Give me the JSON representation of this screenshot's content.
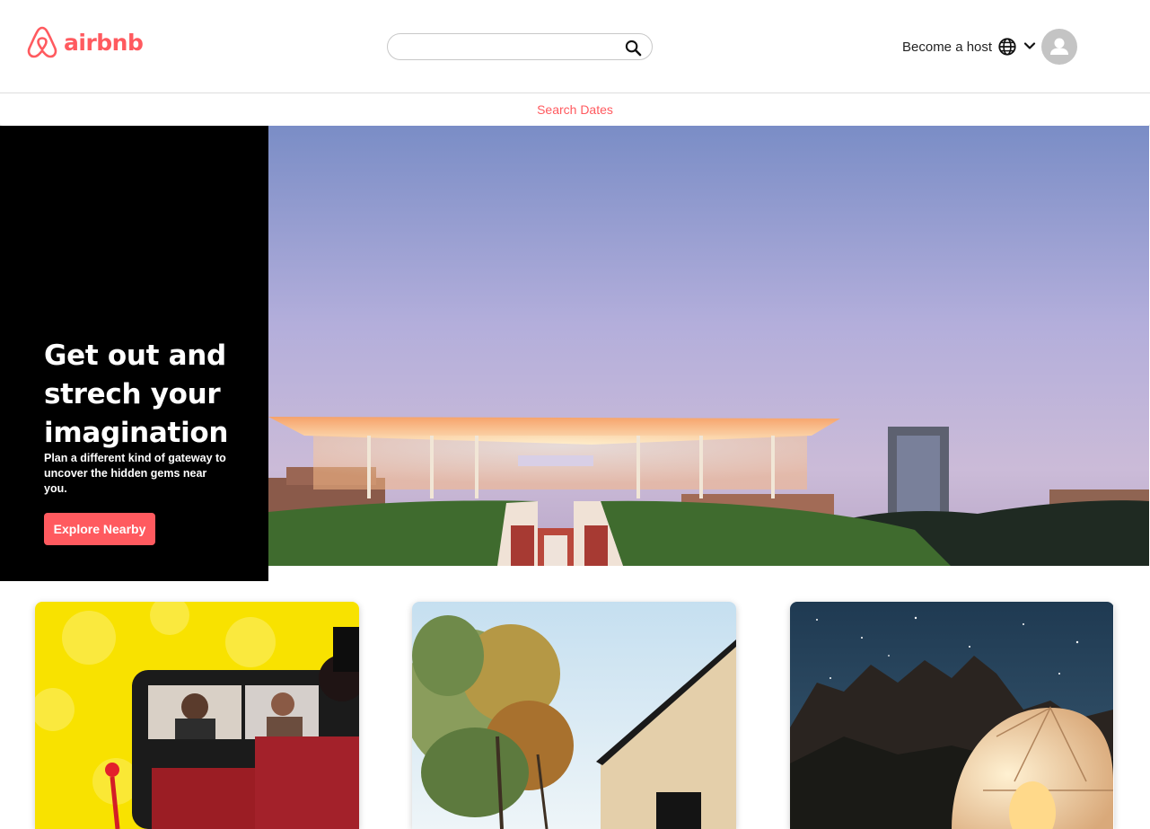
{
  "header": {
    "logo_text": "airbnb",
    "search": {
      "value": "",
      "placeholder": ""
    },
    "host_label": "Become a host",
    "icons": {
      "search": "search-icon",
      "globe": "globe-icon",
      "chevron": "chevron-down-icon",
      "avatar": "user-avatar-icon"
    }
  },
  "dates_bar": {
    "label": "Search Dates"
  },
  "hero": {
    "title": "Get out and strech your imagination",
    "subtitle": "Plan a different kind of gateway to uncover the hidden gems near you.",
    "cta_label": "Explore Nearby"
  },
  "colors": {
    "brand": "#ff5a5f",
    "hero_panel": "#000000"
  }
}
